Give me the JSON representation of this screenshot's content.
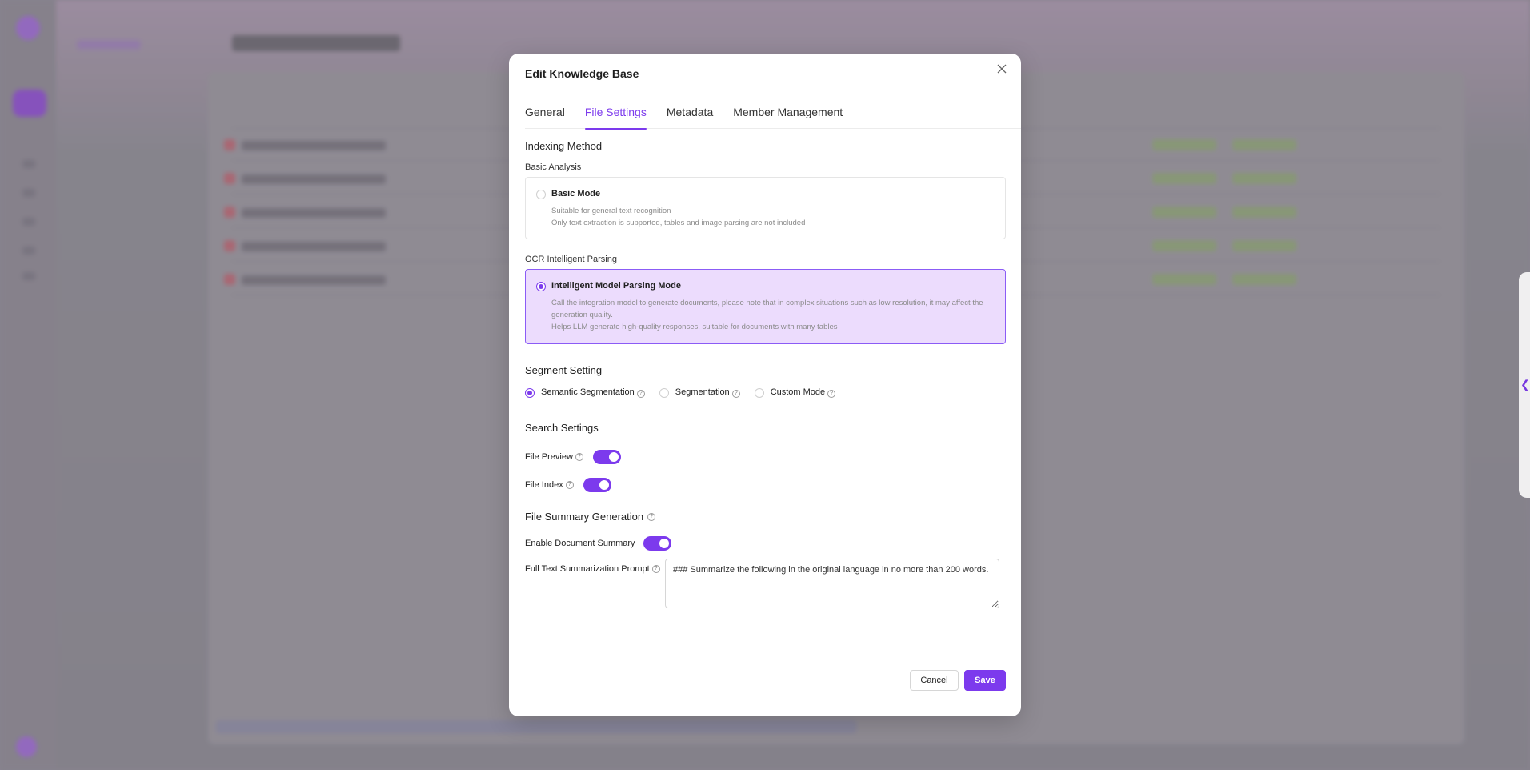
{
  "modal": {
    "title": "Edit Knowledge Base",
    "close_icon": "close-icon"
  },
  "tabs": [
    {
      "label": "General",
      "active": false
    },
    {
      "label": "File Settings",
      "active": true
    },
    {
      "label": "Metadata",
      "active": false
    },
    {
      "label": "Member Management",
      "active": false
    }
  ],
  "indexing": {
    "title": "Indexing Method",
    "basic_label": "Basic Analysis",
    "basic_mode": {
      "title": "Basic Mode",
      "desc1": "Suitable for general text recognition",
      "desc2": "Only text extraction is supported, tables and image parsing are not included",
      "selected": false
    },
    "ocr_label": "OCR Intelligent Parsing",
    "intelligent_mode": {
      "title": "Intelligent Model Parsing Mode",
      "desc1": "Call the integration model to generate documents, please note that in complex situations such as low resolution, it may affect the generation quality.",
      "desc2": "Helps LLM generate high-quality responses, suitable for documents with many tables",
      "selected": true
    }
  },
  "segment": {
    "title": "Segment Setting",
    "options": [
      {
        "label": "Semantic Segmentation",
        "checked": true
      },
      {
        "label": "Segmentation",
        "checked": false
      },
      {
        "label": "Custom Mode",
        "checked": false
      }
    ]
  },
  "search": {
    "title": "Search Settings",
    "file_preview": {
      "label": "File Preview",
      "enabled": true
    },
    "file_index": {
      "label": "File Index",
      "enabled": true
    }
  },
  "summary": {
    "title": "File Summary Generation",
    "enable_label": "Enable Document Summary",
    "enabled": true,
    "prompt_label": "Full Text Summarization Prompt",
    "prompt_value": "### Summarize the following in the original language in no more than 200 words."
  },
  "footer": {
    "cancel_label": "Cancel",
    "save_label": "Save"
  },
  "colors": {
    "accent": "#7c3aed",
    "selected_card_bg": "#ecdcfd"
  }
}
